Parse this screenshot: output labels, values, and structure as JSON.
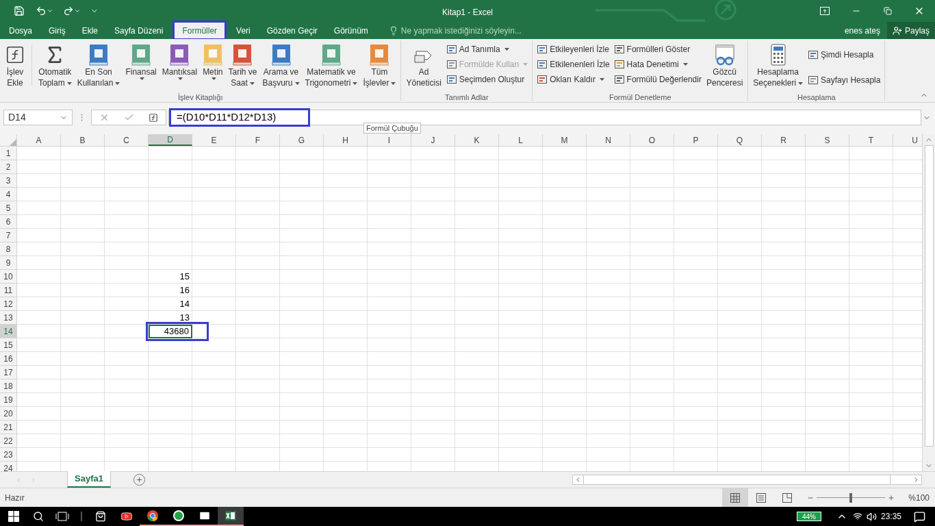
{
  "window": {
    "title": "Kitap1 - Excel"
  },
  "tabs": [
    {
      "label": "Dosya",
      "selected": false,
      "highlighted": false
    },
    {
      "label": "Giriş",
      "selected": false,
      "highlighted": false
    },
    {
      "label": "Ekle",
      "selected": false,
      "highlighted": false
    },
    {
      "label": "Sayfa Düzeni",
      "selected": false,
      "highlighted": false
    },
    {
      "label": "Formüller",
      "selected": true,
      "highlighted": true
    },
    {
      "label": "Veri",
      "selected": false,
      "highlighted": false
    },
    {
      "label": "Gözden Geçir",
      "selected": false,
      "highlighted": false
    },
    {
      "label": "Görünüm",
      "selected": false,
      "highlighted": false
    }
  ],
  "tell_me": {
    "placeholder": "Ne yapmak istediğinizi söyleyin..."
  },
  "account": {
    "user": "enes ateş",
    "share": "Paylaş"
  },
  "ribbon": [
    {
      "label": "İşlev Kitaplığı",
      "items": [
        {
          "kind": "large",
          "lines": [
            "İşlev",
            "Ekle"
          ],
          "dropdown": false,
          "disabled": false
        },
        {
          "kind": "large",
          "lines": [
            "Otomatik",
            "Toplam"
          ],
          "dropdown": true,
          "disabled": false
        },
        {
          "kind": "large",
          "lines": [
            "En Son",
            "Kullanılan"
          ],
          "dropdown": true,
          "disabled": false
        },
        {
          "kind": "large",
          "lines": [
            "Finansal"
          ],
          "dropdown": true,
          "disabled": false
        },
        {
          "kind": "large",
          "lines": [
            "Mantıksal"
          ],
          "dropdown": true,
          "disabled": false
        },
        {
          "kind": "large",
          "lines": [
            "Metin"
          ],
          "dropdown": true,
          "disabled": false
        },
        {
          "kind": "large",
          "lines": [
            "Tarih ve",
            "Saat"
          ],
          "dropdown": true,
          "disabled": false
        },
        {
          "kind": "large",
          "lines": [
            "Arama ve",
            "Başvuru"
          ],
          "dropdown": true,
          "disabled": false
        },
        {
          "kind": "large",
          "lines": [
            "Matematik ve",
            "Trigonometri"
          ],
          "dropdown": true,
          "disabled": false
        },
        {
          "kind": "large",
          "lines": [
            "Tüm",
            "İşlevler"
          ],
          "dropdown": true,
          "disabled": false
        }
      ]
    },
    {
      "label": "Tanımlı Adlar",
      "items": [
        {
          "kind": "large",
          "lines": [
            "Ad",
            "Yöneticisi"
          ],
          "dropdown": false,
          "disabled": false
        },
        {
          "kind": "small",
          "lines": [
            "Ad Tanımla"
          ],
          "dropdown": true,
          "disabled": false
        },
        {
          "kind": "small",
          "lines": [
            "Formülde Kullan"
          ],
          "dropdown": true,
          "disabled": true
        },
        {
          "kind": "small",
          "lines": [
            "Seçimden Oluştur"
          ],
          "dropdown": false,
          "disabled": false
        }
      ]
    },
    {
      "label": "Formül Denetleme",
      "items": [
        {
          "kind": "small",
          "lines": [
            "Etkileyenleri İzle"
          ],
          "dropdown": false,
          "disabled": false
        },
        {
          "kind": "small",
          "lines": [
            "Etkilenenleri İzle"
          ],
          "dropdown": false,
          "disabled": false
        },
        {
          "kind": "small",
          "lines": [
            "Okları Kaldır"
          ],
          "dropdown": true,
          "disabled": false
        },
        {
          "kind": "small",
          "lines": [
            "Formülleri Göster"
          ],
          "dropdown": false,
          "disabled": false
        },
        {
          "kind": "small",
          "lines": [
            "Hata Denetimi"
          ],
          "dropdown": true,
          "disabled": false
        },
        {
          "kind": "small",
          "lines": [
            "Formülü Değerlendir"
          ],
          "dropdown": false,
          "disabled": false
        },
        {
          "kind": "large",
          "lines": [
            "Gözcü",
            "Penceresi"
          ],
          "dropdown": false,
          "disabled": false
        }
      ]
    },
    {
      "label": "Hesaplama",
      "items": [
        {
          "kind": "large",
          "lines": [
            "Hesaplama",
            "Seçenekleri"
          ],
          "dropdown": true,
          "disabled": false
        },
        {
          "kind": "small",
          "lines": [
            "Şimdi Hesapla"
          ],
          "dropdown": false,
          "disabled": false
        },
        {
          "kind": "small",
          "lines": [
            "Sayfayı Hesapla"
          ],
          "dropdown": false,
          "disabled": false
        }
      ]
    }
  ],
  "formula_bar": {
    "name_box": "D14",
    "formula": "=(D10*D11*D12*D13)",
    "highlighted": true,
    "tooltip": "Formül Çubuğu"
  },
  "columns": [
    {
      "label": "A",
      "selected": false
    },
    {
      "label": "B",
      "selected": false
    },
    {
      "label": "C",
      "selected": false
    },
    {
      "label": "D",
      "selected": true
    },
    {
      "label": "E",
      "selected": false
    },
    {
      "label": "F",
      "selected": false
    },
    {
      "label": "G",
      "selected": false
    },
    {
      "label": "H",
      "selected": false
    },
    {
      "label": "I",
      "selected": false
    },
    {
      "label": "J",
      "selected": false
    },
    {
      "label": "K",
      "selected": false
    },
    {
      "label": "L",
      "selected": false
    },
    {
      "label": "M",
      "selected": false
    },
    {
      "label": "N",
      "selected": false
    },
    {
      "label": "O",
      "selected": false
    },
    {
      "label": "P",
      "selected": false
    },
    {
      "label": "Q",
      "selected": false
    },
    {
      "label": "R",
      "selected": false
    },
    {
      "label": "S",
      "selected": false
    },
    {
      "label": "T",
      "selected": false
    },
    {
      "label": "U",
      "selected": false
    }
  ],
  "rows": [
    {
      "label": "1",
      "selected": false
    },
    {
      "label": "2",
      "selected": false
    },
    {
      "label": "3",
      "selected": false
    },
    {
      "label": "4",
      "selected": false
    },
    {
      "label": "5",
      "selected": false
    },
    {
      "label": "6",
      "selected": false
    },
    {
      "label": "7",
      "selected": false
    },
    {
      "label": "8",
      "selected": false
    },
    {
      "label": "9",
      "selected": false
    },
    {
      "label": "10",
      "selected": false,
      "cells": [
        null,
        null,
        null,
        {
          "text": "15",
          "selected": false,
          "highlighted": false
        }
      ]
    },
    {
      "label": "11",
      "selected": false,
      "cells": [
        null,
        null,
        null,
        {
          "text": "16",
          "selected": false,
          "highlighted": false
        }
      ]
    },
    {
      "label": "12",
      "selected": false,
      "cells": [
        null,
        null,
        null,
        {
          "text": "14",
          "selected": false,
          "highlighted": false
        }
      ]
    },
    {
      "label": "13",
      "selected": false,
      "cells": [
        null,
        null,
        null,
        {
          "text": "13",
          "selected": false,
          "highlighted": false
        }
      ]
    },
    {
      "label": "14",
      "selected": true,
      "cells": [
        null,
        null,
        null,
        {
          "text": "43680",
          "selected": true,
          "highlighted": true
        }
      ]
    },
    {
      "label": "15",
      "selected": false
    },
    {
      "label": "16",
      "selected": false
    },
    {
      "label": "17",
      "selected": false
    },
    {
      "label": "18",
      "selected": false
    },
    {
      "label": "19",
      "selected": false
    },
    {
      "label": "20",
      "selected": false
    },
    {
      "label": "21",
      "selected": false
    },
    {
      "label": "22",
      "selected": false
    },
    {
      "label": "23",
      "selected": false
    },
    {
      "label": "24",
      "selected": false
    }
  ],
  "sheets": [
    {
      "label": "Sayfa1",
      "selected": true
    }
  ],
  "status_bar": {
    "text": "Hazır",
    "views": [
      {
        "selected": true
      },
      {
        "selected": false
      },
      {
        "selected": false
      }
    ],
    "zoom": {
      "level": 0.5,
      "reading": "%100"
    }
  },
  "taskbar": {
    "apps": [
      {
        "running": false,
        "active": false
      },
      {
        "running": false,
        "active": false
      },
      {
        "running": true,
        "active": false
      },
      {
        "running": true,
        "active": false
      },
      {
        "running": true,
        "active": false
      },
      {
        "running": true,
        "active": true
      }
    ],
    "battery": "44%",
    "clock": "23:35"
  }
}
